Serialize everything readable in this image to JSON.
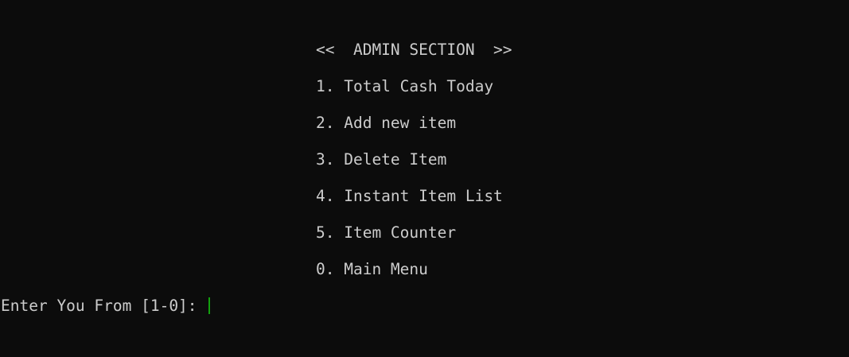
{
  "console": {
    "title": "<<  ADMIN SECTION  >>",
    "menu_items": [
      "1. Total Cash Today",
      "2. Add new item",
      "3. Delete Item",
      "4. Instant Item List",
      "5. Item Counter",
      "0. Main Menu"
    ],
    "prompt": "Enter You From [1-0]: ",
    "input_value": ""
  },
  "colors": {
    "background": "#0c0c0c",
    "text": "#cccccc",
    "cursor": "#13a10e"
  }
}
